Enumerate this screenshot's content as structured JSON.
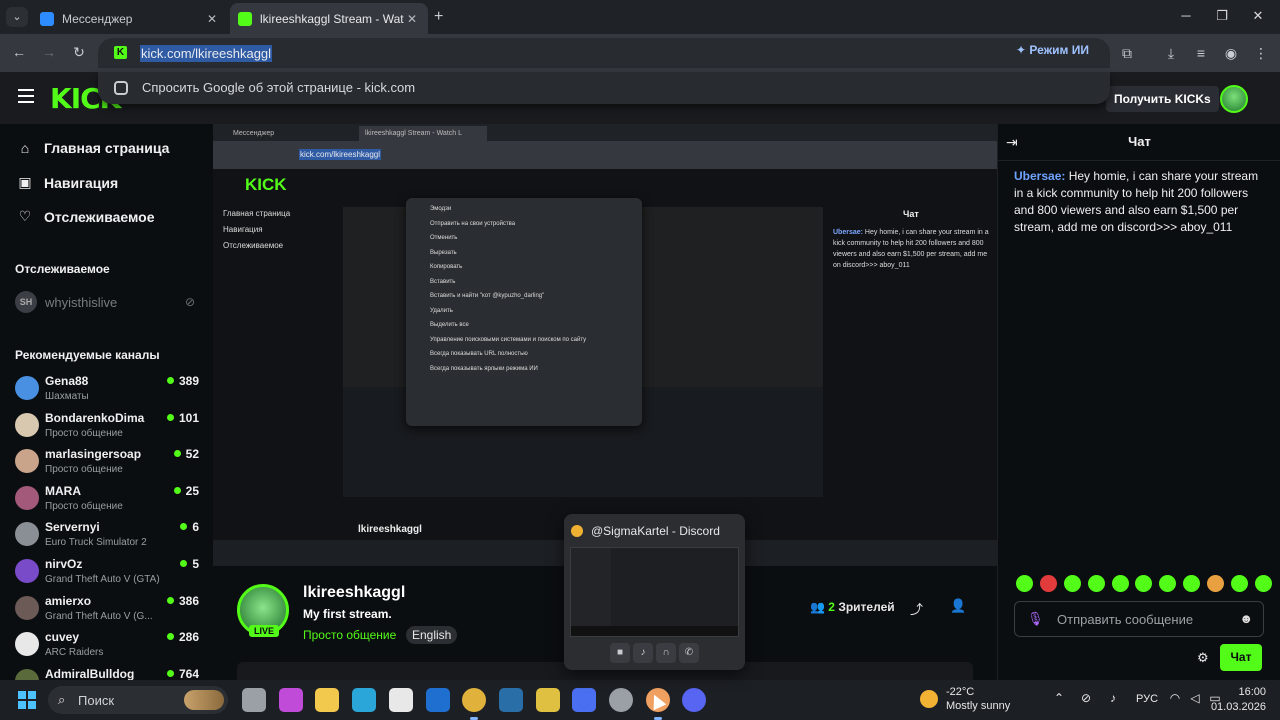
{
  "browser": {
    "tabs": [
      {
        "title": "Мессенджер",
        "active": false,
        "favicon_color": "#2d8cff"
      },
      {
        "title": "lkireeshkaggl Stream - Watch Li",
        "active": true,
        "favicon_color": "#53fc18"
      }
    ],
    "url": "kick.com/lkireeshkaggl",
    "ai_mode_label": "Режим ИИ",
    "suggestion": "Спросить Google об этой странице - kick.com"
  },
  "header": {
    "logo": "KICK",
    "get_kicks_label": "Получить KICKs"
  },
  "sidebar": {
    "nav": [
      {
        "label": "Главная страница",
        "icon": "home-icon",
        "glyph": "⌂"
      },
      {
        "label": "Навигация",
        "icon": "browse-icon",
        "glyph": "▣"
      },
      {
        "label": "Отслеживаемое",
        "icon": "heart-icon",
        "glyph": "♡"
      }
    ],
    "following_title": "Отслеживаемое",
    "following": [
      {
        "name": "whyisthislive",
        "avatar_text": "SH"
      }
    ],
    "recommended_title": "Рекомендуемые каналы",
    "channels": [
      {
        "name": "Gena88",
        "category": "Шахматы",
        "viewers": "389",
        "color": "#4a90e2"
      },
      {
        "name": "BondarenkoDima",
        "category": "Просто общение",
        "viewers": "101",
        "color": "#d8c8b0"
      },
      {
        "name": "marlasingersoap",
        "category": "Просто общение",
        "viewers": "52",
        "color": "#c9a38a"
      },
      {
        "name": "MARA",
        "category": "Просто общение",
        "viewers": "25",
        "color": "#a35a7a"
      },
      {
        "name": "Servernyi",
        "category": "Euro Truck Simulator 2",
        "viewers": "6",
        "color": "#8a8f96"
      },
      {
        "name": "nirvOz",
        "category": "Grand Theft Auto V (GTA)",
        "viewers": "5",
        "color": "#7a4bc8"
      },
      {
        "name": "amierxo",
        "category": "Grand Theft Auto V (G...",
        "viewers": "386",
        "color": "#6b5a55"
      },
      {
        "name": "cuvey",
        "category": "ARC Raiders",
        "viewers": "286",
        "color": "#e8e8e8"
      },
      {
        "name": "AdmiralBulldog",
        "category": "",
        "viewers": "764",
        "color": "#5a6a3a"
      }
    ]
  },
  "stream": {
    "streamer": "lkireeshkaggl",
    "title": "My first stream.",
    "category": "Просто общение",
    "language": "English",
    "live_label": "LIVE",
    "viewers_count": "2",
    "viewers_label": "Зрителей"
  },
  "nested": {
    "tab1": "Мессенджер",
    "tab2": "lkireeshkaggl Stream - Watch L",
    "url": "kick.com/lkireeshkaggl",
    "logo": "KICK",
    "sidebar": [
      "Главная страница",
      "Навигация",
      "Отслеживаемое"
    ],
    "menu": [
      "Эмодзи",
      "Отправить на свои устройства",
      "Отменить",
      "Вырезать",
      "Копировать",
      "Вставить",
      "Вставить и найти \"кот @kypuzho_darling\"",
      "Удалить",
      "Выделить все",
      "Управление поисковыми системами и поиском по сайту",
      "Всегда показывать URL полностью",
      "Всегда показывать ярлыки режима ИИ"
    ],
    "chat_title": "Чат",
    "chat_user": "Ubersae:",
    "chat_text": "Hey homie, i can share your stream in a kick community to help hit 200 followers and 800 viewers and also earn $1,500 per stream, add me on discord>>> aboy_011",
    "streamer": "lkireeshkaggl"
  },
  "chat": {
    "title": "Чат",
    "messages": [
      {
        "user": "Ubersae:",
        "text": " Hey homie, i can share your stream in a kick community to help hit 200 followers and 800 viewers and also earn $1,500 per stream, add me on discord>>> aboy_011",
        "user_color": "#6fa3ff"
      }
    ],
    "emotes": [
      "#53fc18",
      "#e23b3b",
      "#53fc18",
      "#53fc18",
      "#53fc18",
      "#53fc18",
      "#53fc18",
      "#53fc18",
      "#e8a040",
      "#53fc18",
      "#53fc18"
    ],
    "input_placeholder": "Отправить сообщение",
    "send_label": "Чат"
  },
  "discord_preview": {
    "title": "@SigmaKartel - Discord"
  },
  "taskbar": {
    "search_placeholder": "Поиск",
    "weather_temp": "-22°C",
    "weather_desc": "Mostly sunny",
    "language": "РУС",
    "time": "16:00",
    "date": "01.03.2026",
    "apps": [
      {
        "name": "task-view",
        "color": "#9aa0a6"
      },
      {
        "name": "copilot",
        "color": "#c04bd8"
      },
      {
        "name": "file-explorer",
        "color": "#f2c94c"
      },
      {
        "name": "edge",
        "color": "#2aa6d8"
      },
      {
        "name": "store",
        "color": "#e8e8e8"
      },
      {
        "name": "outlook",
        "color": "#1f6fd0"
      },
      {
        "name": "chrome",
        "color": "#e0b23c"
      },
      {
        "name": "steam",
        "color": "#2a6ea8"
      },
      {
        "name": "game-app",
        "color": "#e0c040"
      },
      {
        "name": "roblox",
        "color": "#4a6ff0"
      },
      {
        "name": "app-circle",
        "color": "#9aa0a6"
      },
      {
        "name": "yandex-browser",
        "color": "#f0a060"
      },
      {
        "name": "discord",
        "color": "#5865f2"
      }
    ]
  }
}
